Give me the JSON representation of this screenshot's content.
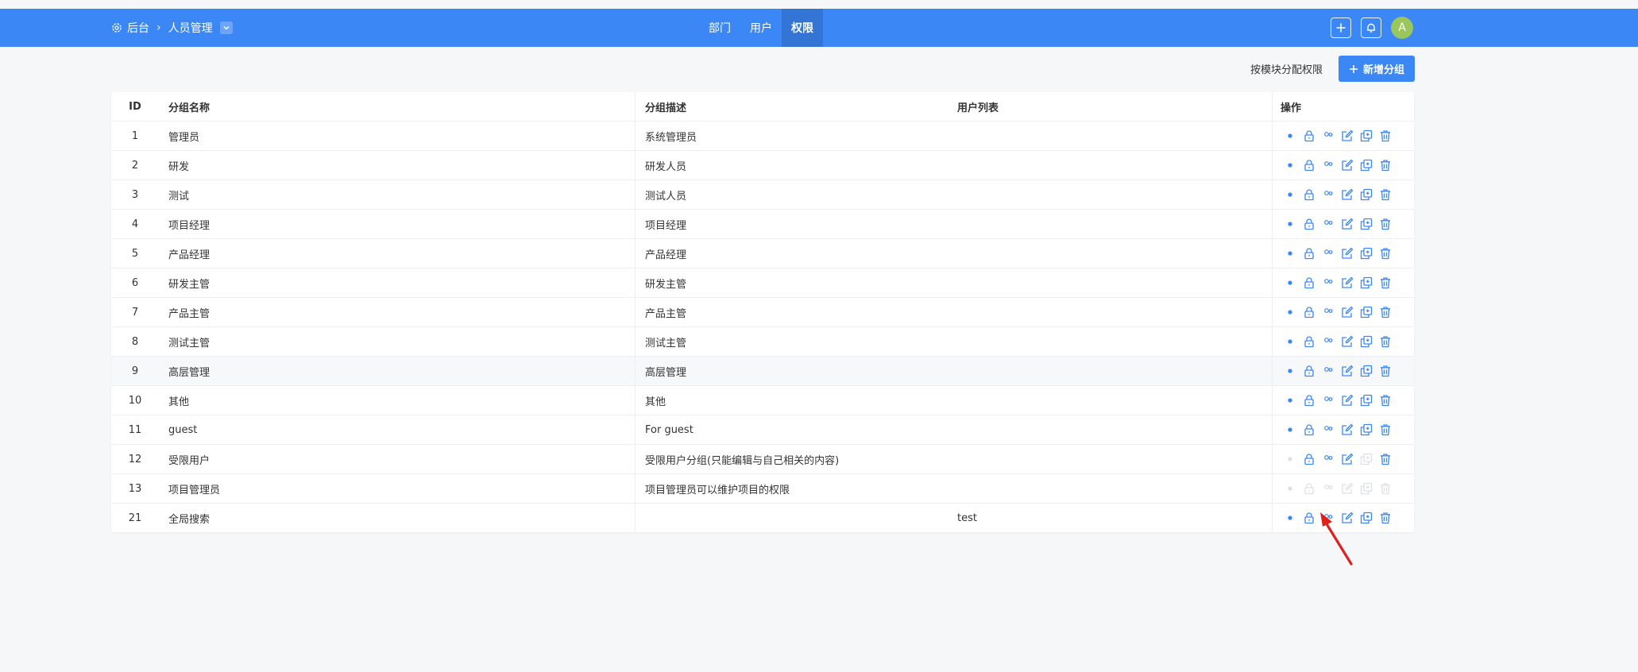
{
  "header": {
    "breadcrumb": {
      "root": "后台",
      "current": "人员管理"
    },
    "tabs": [
      {
        "label": "部门",
        "active": false
      },
      {
        "label": "用户",
        "active": false
      },
      {
        "label": "权限",
        "active": true
      }
    ],
    "avatar_initial": "A",
    "accent_color": "#3b87f5"
  },
  "toolbar": {
    "assign_by_module": "按模块分配权限",
    "add_group": "新增分组"
  },
  "table": {
    "columns": [
      "ID",
      "分组名称",
      "分组描述",
      "用户列表",
      "操作"
    ],
    "rows": [
      {
        "id": "1",
        "name": "管理员",
        "desc": "系统管理员",
        "users": "",
        "ops_disabled": []
      },
      {
        "id": "2",
        "name": "研发",
        "desc": "研发人员",
        "users": "",
        "ops_disabled": []
      },
      {
        "id": "3",
        "name": "测试",
        "desc": "测试人员",
        "users": "",
        "ops_disabled": []
      },
      {
        "id": "4",
        "name": "项目经理",
        "desc": "项目经理",
        "users": "",
        "ops_disabled": []
      },
      {
        "id": "5",
        "name": "产品经理",
        "desc": "产品经理",
        "users": "",
        "ops_disabled": []
      },
      {
        "id": "6",
        "name": "研发主管",
        "desc": "研发主管",
        "users": "",
        "ops_disabled": []
      },
      {
        "id": "7",
        "name": "产品主管",
        "desc": "产品主管",
        "users": "",
        "ops_disabled": []
      },
      {
        "id": "8",
        "name": "测试主管",
        "desc": "测试主管",
        "users": "",
        "ops_disabled": []
      },
      {
        "id": "9",
        "name": "高层管理",
        "desc": "高层管理",
        "users": "",
        "ops_disabled": [],
        "hover": true
      },
      {
        "id": "10",
        "name": "其他",
        "desc": "其他",
        "users": "",
        "ops_disabled": []
      },
      {
        "id": "11",
        "name": "guest",
        "desc": "For guest",
        "users": "",
        "ops_disabled": []
      },
      {
        "id": "12",
        "name": "受限用户",
        "desc": "受限用户分组(只能编辑与自己相关的内容)",
        "users": "",
        "ops_disabled": [
          "view",
          "copy"
        ]
      },
      {
        "id": "13",
        "name": "项目管理员",
        "desc": "项目管理员可以维护项目的权限",
        "users": "",
        "ops_disabled": [
          "view",
          "lock",
          "members",
          "edit",
          "copy",
          "delete"
        ]
      },
      {
        "id": "21",
        "name": "全局搜索",
        "desc": "",
        "users": "test",
        "ops_disabled": []
      }
    ],
    "op_icons": [
      "eye-icon",
      "lock-icon",
      "users-icon",
      "edit-icon",
      "copy-icon",
      "trash-icon"
    ]
  },
  "annotation_color": "#e0201c"
}
